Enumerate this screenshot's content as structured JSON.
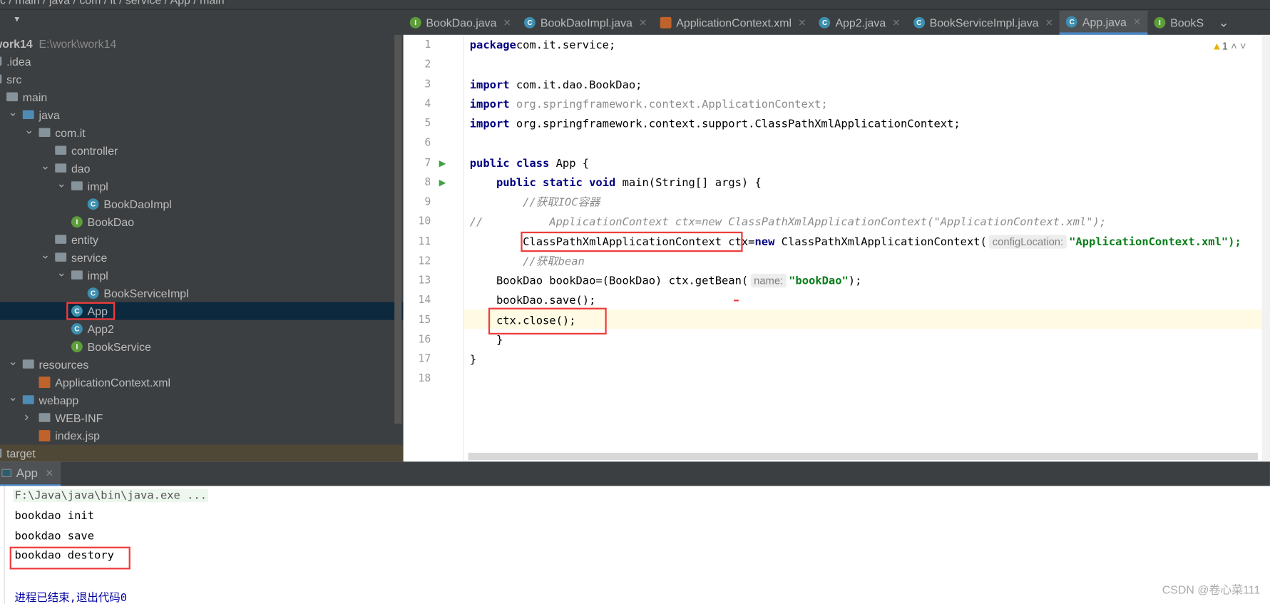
{
  "breadcrumb": "c / main / java / com / it / service / App / main",
  "run_config": "App",
  "editor_tabs": [
    {
      "label": "BookDao.java",
      "icon": "interface-icon",
      "active": false
    },
    {
      "label": "BookDaoImpl.java",
      "icon": "class-icon",
      "active": false
    },
    {
      "label": "ApplicationContext.xml",
      "icon": "xml-icon",
      "active": false
    },
    {
      "label": "App2.java",
      "icon": "class-icon",
      "active": false
    },
    {
      "label": "BookServiceImpl.java",
      "icon": "class-icon",
      "active": false
    },
    {
      "label": "App.java",
      "icon": "class-icon",
      "active": true
    },
    {
      "label": "BookS",
      "icon": "interface-icon",
      "active": false
    }
  ],
  "project": {
    "name": "work14",
    "path": "E:\\work\\work14"
  },
  "tree": [
    {
      "label": ".idea",
      "d": 0,
      "type": "folder"
    },
    {
      "label": "src",
      "d": 0,
      "type": "folder",
      "open": true
    },
    {
      "label": "main",
      "d": 1,
      "type": "folder"
    },
    {
      "label": "java",
      "d": 2,
      "type": "src",
      "open": true
    },
    {
      "label": "com.it",
      "d": 3,
      "type": "folder",
      "open": true
    },
    {
      "label": "controller",
      "d": 4,
      "type": "folder"
    },
    {
      "label": "dao",
      "d": 4,
      "type": "folder",
      "open": true
    },
    {
      "label": "impl",
      "d": 5,
      "type": "folder",
      "open": true
    },
    {
      "label": "BookDaoImpl",
      "d": 6,
      "type": "class"
    },
    {
      "label": "BookDao",
      "d": 5,
      "type": "interface"
    },
    {
      "label": "entity",
      "d": 4,
      "type": "folder"
    },
    {
      "label": "service",
      "d": 4,
      "type": "folder",
      "open": true
    },
    {
      "label": "impl",
      "d": 5,
      "type": "folder",
      "open": true
    },
    {
      "label": "BookServiceImpl",
      "d": 6,
      "type": "class"
    },
    {
      "label": "App",
      "d": 5,
      "type": "class",
      "selected": true,
      "boxed": true
    },
    {
      "label": "App2",
      "d": 5,
      "type": "class"
    },
    {
      "label": "BookService",
      "d": 5,
      "type": "interface"
    },
    {
      "label": "resources",
      "d": 2,
      "type": "folder",
      "open": true
    },
    {
      "label": "ApplicationContext.xml",
      "d": 3,
      "type": "xml"
    },
    {
      "label": "webapp",
      "d": 2,
      "type": "src",
      "open": true
    },
    {
      "label": "WEB-INF",
      "d": 3,
      "type": "folder",
      "closed": true
    },
    {
      "label": "index.jsp",
      "d": 3,
      "type": "xml"
    },
    {
      "label": "target",
      "d": 0,
      "type": "folder",
      "target": true
    }
  ],
  "warnings": "1",
  "code": [
    [
      [
        "kw",
        "package"
      ],
      [
        "",
        "com.it.service;"
      ]
    ],
    [],
    [
      [
        "kw",
        "import"
      ],
      [
        "",
        " com.it.dao.BookDao;"
      ]
    ],
    [
      [
        "kw",
        "import"
      ],
      [
        "gr",
        " org.springframework.context.ApplicationContext;"
      ]
    ],
    [
      [
        "kw",
        "import"
      ],
      [
        "",
        " org.springframework.context.support.ClassPathXmlApplicationContext;"
      ]
    ],
    [],
    [
      [
        "kw",
        "public class"
      ],
      [
        "",
        " App {"
      ]
    ],
    [
      [
        "",
        "    "
      ],
      [
        "kw",
        "public static void"
      ],
      [
        "",
        " main(String[] args) {"
      ]
    ],
    [
      [
        "cm",
        "        //获取IOC容器"
      ]
    ],
    [
      [
        "cm",
        "//          ApplicationContext ctx=new ClassPathXmlApplicationContext(\"ApplicationContext.xml\");"
      ]
    ],
    [
      [
        "",
        "        ClassPathXmlApplicationContext ctx="
      ],
      [
        "kw",
        "new"
      ],
      [
        "",
        " ClassPathXmlApplicationContext("
      ],
      [
        "ph",
        "configLocation:"
      ],
      [
        "st",
        "\"ApplicationContext.xml\");"
      ]
    ],
    [
      [
        "cm",
        "        //获取bean"
      ]
    ],
    [
      [
        "",
        "    BookDao bookDao=(BookDao) ctx.getBean("
      ],
      [
        "ph",
        "name:"
      ],
      [
        "st",
        "\"bookDao\""
      ],
      [
        "",
        ");"
      ]
    ],
    [
      [
        "",
        "    bookDao.save();"
      ]
    ],
    [
      [
        "",
        "    ctx.close();"
      ]
    ],
    [
      [
        "",
        "    }"
      ]
    ],
    [
      [
        "",
        "}"
      ]
    ],
    []
  ],
  "run_tab": "App",
  "console": {
    "command": "F:\\Java\\java\\bin\\java.exe ...",
    "lines": [
      "bookdao init",
      "bookdao save",
      "bookdao destory"
    ],
    "exit": "进程已结束,退出代码0"
  },
  "watermark": "CSDN @卷心菜111"
}
